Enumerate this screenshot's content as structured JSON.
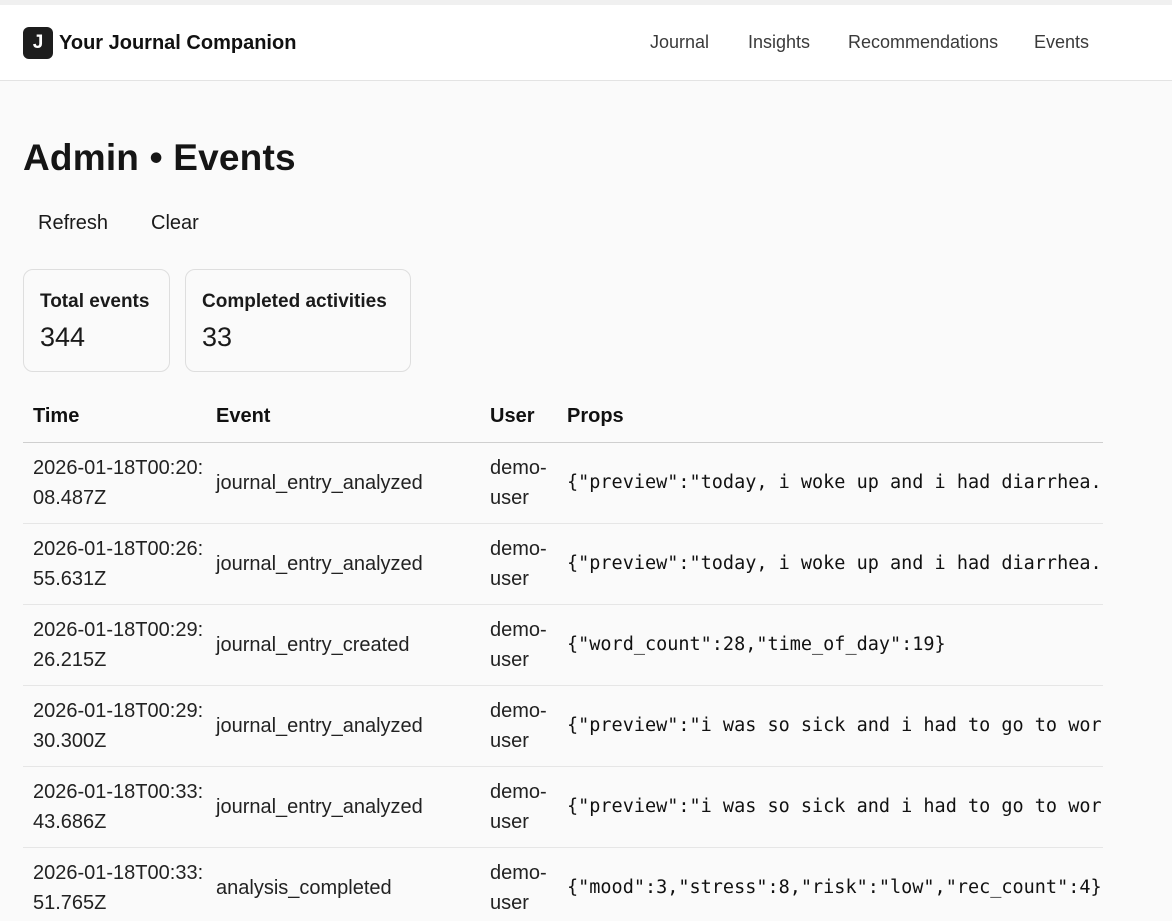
{
  "header": {
    "logo_letter": "J",
    "app_name": "Your Journal Companion",
    "nav": [
      "Journal",
      "Insights",
      "Recommendations",
      "Events"
    ]
  },
  "page": {
    "title": "Admin • Events",
    "actions": {
      "refresh": "Refresh",
      "clear": "Clear"
    }
  },
  "stats": [
    {
      "label": "Total events",
      "value": "344"
    },
    {
      "label": "Completed activities",
      "value": "33"
    }
  ],
  "table": {
    "columns": [
      "Time",
      "Event",
      "User",
      "Props"
    ],
    "rows": [
      {
        "time": "2026-01-18T00:20:08.487Z",
        "event": "journal_entry_analyzed",
        "user": "demo-user",
        "props": "{\"preview\":\"today, i woke up and i had diarrhea."
      },
      {
        "time": "2026-01-18T00:26:55.631Z",
        "event": "journal_entry_analyzed",
        "user": "demo-user",
        "props": "{\"preview\":\"today, i woke up and i had diarrhea."
      },
      {
        "time": "2026-01-18T00:29:26.215Z",
        "event": "journal_entry_created",
        "user": "demo-user",
        "props": "{\"word_count\":28,\"time_of_day\":19}"
      },
      {
        "time": "2026-01-18T00:29:30.300Z",
        "event": "journal_entry_analyzed",
        "user": "demo-user",
        "props": "{\"preview\":\"i was so sick and i had to go to work"
      },
      {
        "time": "2026-01-18T00:33:43.686Z",
        "event": "journal_entry_analyzed",
        "user": "demo-user",
        "props": "{\"preview\":\"i was so sick and i had to go to work"
      },
      {
        "time": "2026-01-18T00:33:51.765Z",
        "event": "analysis_completed",
        "user": "demo-user",
        "props": "{\"mood\":3,\"stress\":8,\"risk\":\"low\",\"rec_count\":4}"
      }
    ]
  }
}
